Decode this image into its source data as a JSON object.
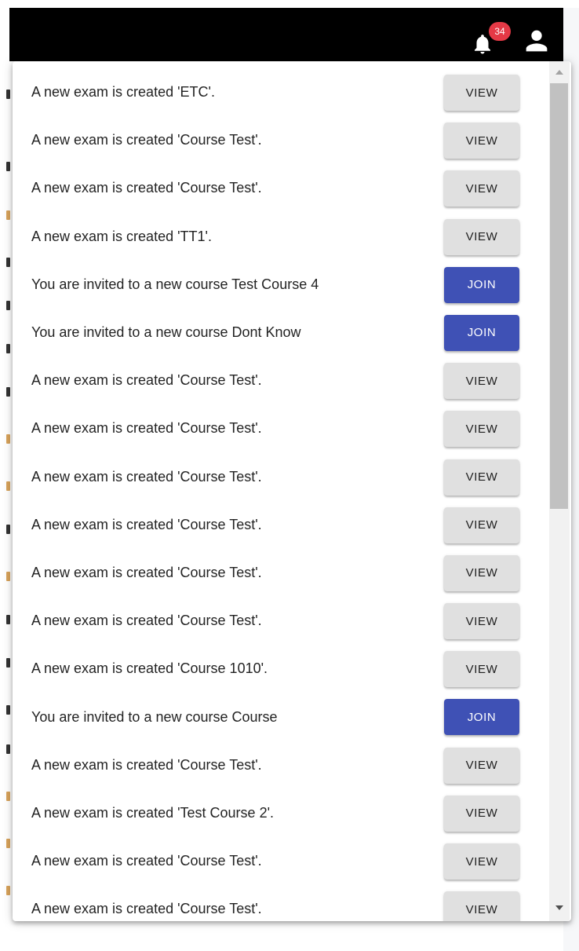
{
  "topbar": {
    "notification_count": "34",
    "icons": {
      "notifications": "bell-icon",
      "account": "user-icon"
    }
  },
  "colors": {
    "topbar": "#000000",
    "badge": "#e53946",
    "join_button": "#3f51b5",
    "view_button": "#e0e0e0"
  },
  "notifications": [
    {
      "message": "A new exam is created 'ETC'.",
      "action": "VIEW"
    },
    {
      "message": "A new exam is created 'Course Test'.",
      "action": "VIEW"
    },
    {
      "message": "A new exam is created 'Course Test'.",
      "action": "VIEW"
    },
    {
      "message": "A new exam is created 'TT1'.",
      "action": "VIEW"
    },
    {
      "message": "You are invited to a new course Test Course 4",
      "action": "JOIN"
    },
    {
      "message": "You are invited to a new course Dont Know",
      "action": "JOIN"
    },
    {
      "message": "A new exam is created 'Course Test'.",
      "action": "VIEW"
    },
    {
      "message": "A new exam is created 'Course Test'.",
      "action": "VIEW"
    },
    {
      "message": "A new exam is created 'Course Test'.",
      "action": "VIEW"
    },
    {
      "message": "A new exam is created 'Course Test'.",
      "action": "VIEW"
    },
    {
      "message": "A new exam is created 'Course Test'.",
      "action": "VIEW"
    },
    {
      "message": "A new exam is created 'Course Test'.",
      "action": "VIEW"
    },
    {
      "message": "A new exam is created 'Course 1010'.",
      "action": "VIEW"
    },
    {
      "message": "You are invited to a new course Course",
      "action": "JOIN"
    },
    {
      "message": "A new exam is created 'Course Test'.",
      "action": "VIEW"
    },
    {
      "message": "A new exam is created 'Test Course 2'.",
      "action": "VIEW"
    },
    {
      "message": "A new exam is created 'Course Test'.",
      "action": "VIEW"
    },
    {
      "message": "A new exam is created 'Course Test'.",
      "action": "VIEW"
    }
  ]
}
